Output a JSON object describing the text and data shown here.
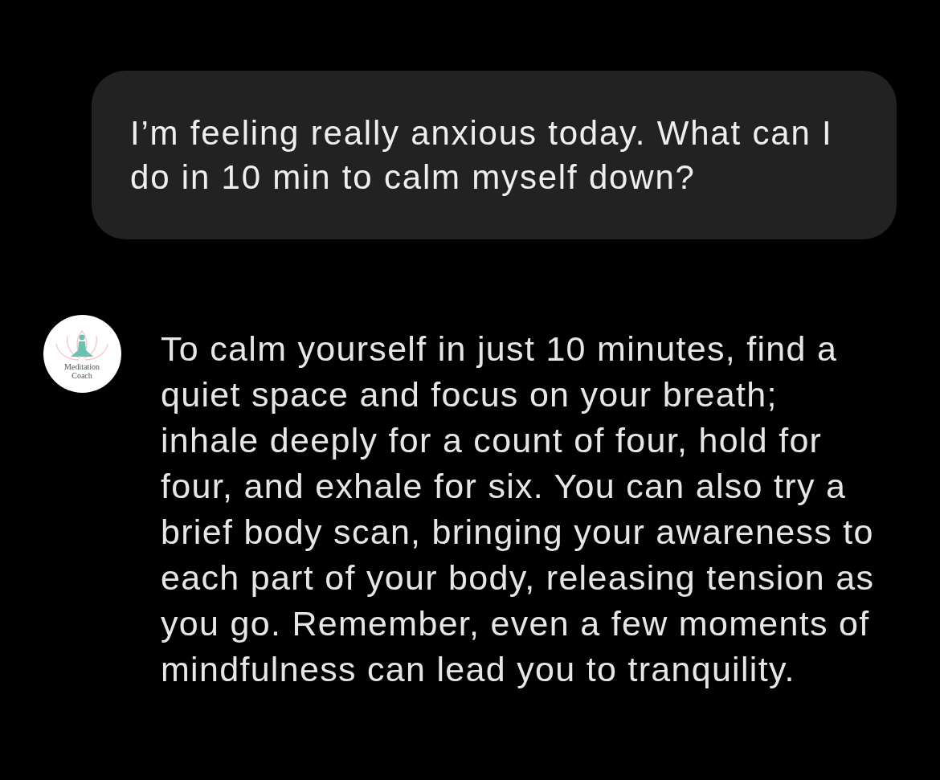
{
  "messages": [
    {
      "kind": "user",
      "text": "I’m feeling really anxious today. What can I do in 10 min to calm myself down?"
    },
    {
      "kind": "bot",
      "avatar": {
        "caption_lines": [
          "Meditation",
          "Coach"
        ]
      },
      "text": "To calm yourself in just 10 minutes, find a quiet space and focus on your breath; inhale deeply for a count of four, hold for four, and exhale for six. You can also try a brief body scan, bringing your awareness to each part of your body, releasing tension as you go. Remember, even a few moments of mindfulness can lead you to tranquility."
    }
  ]
}
